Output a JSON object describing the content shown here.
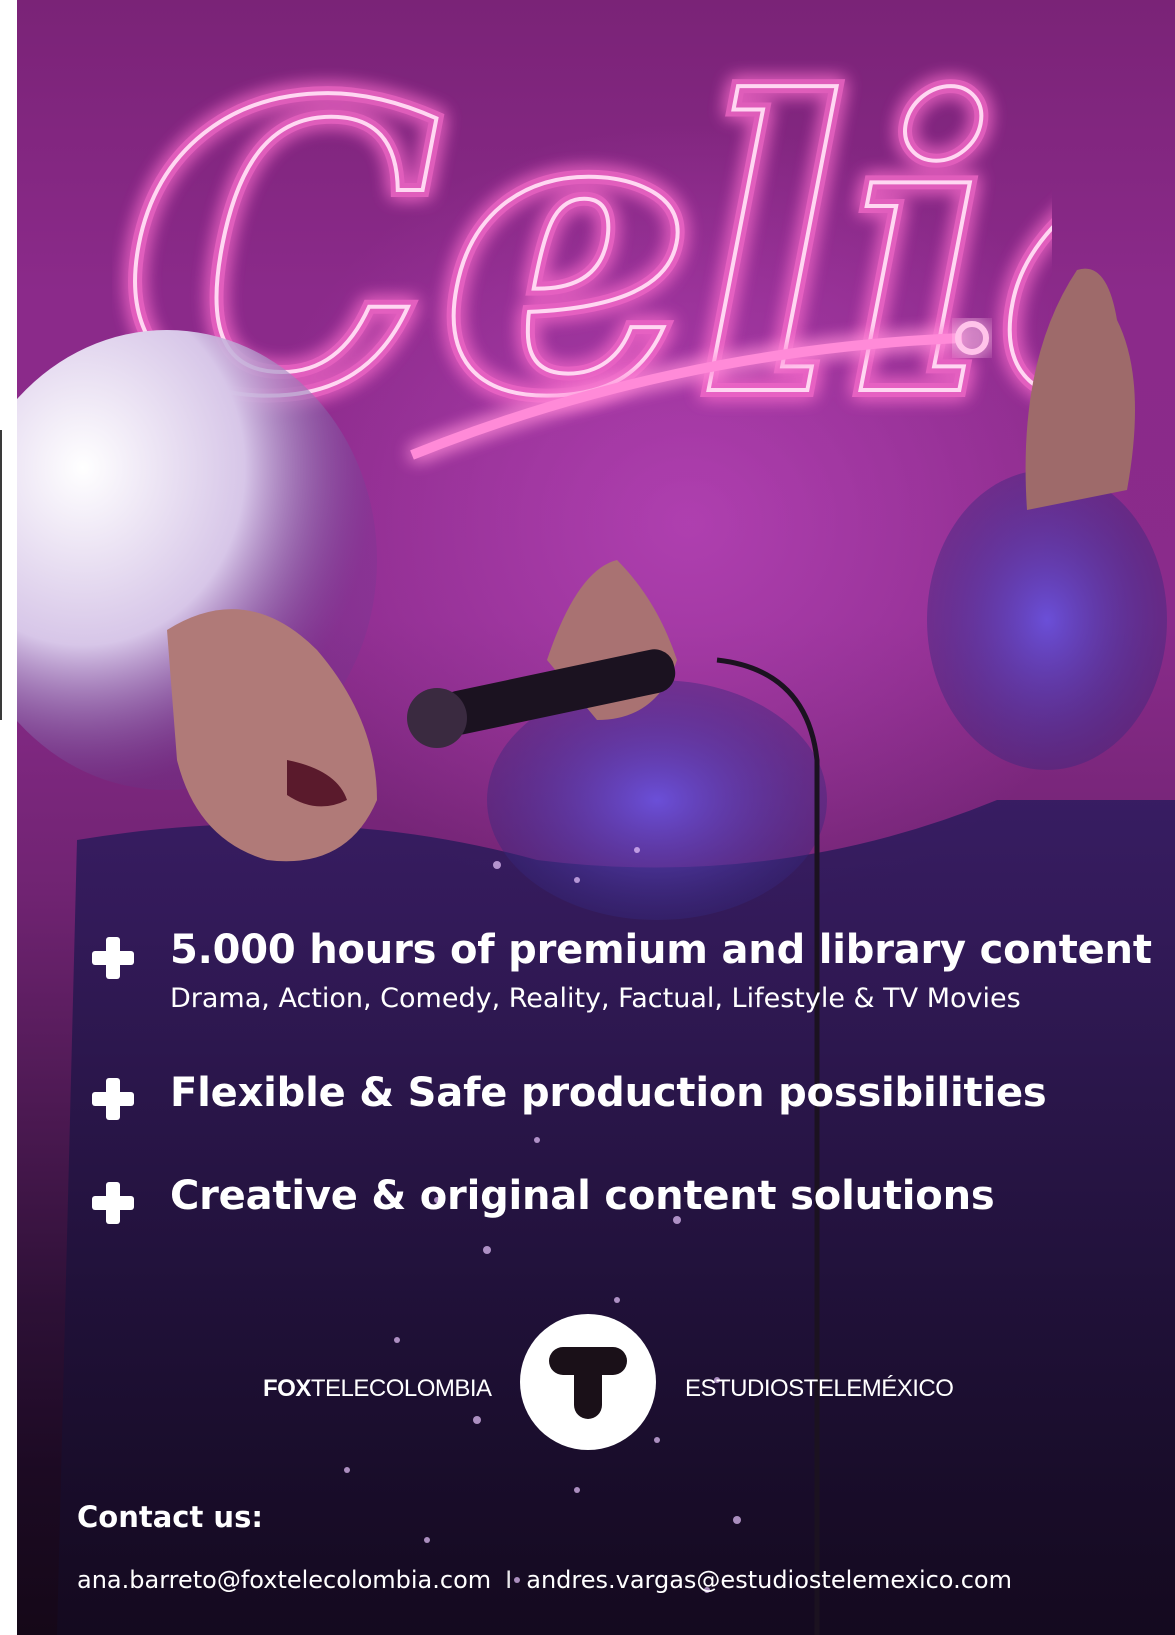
{
  "poster": {
    "title": "Celia",
    "accent_neon": "#ff5fc4",
    "background_color": "#8a2b8b"
  },
  "features": [
    {
      "icon": "plus-icon",
      "title": "5.000 hours of premium and library content",
      "subtitle": "Drama, Action, Comedy, Reality, Factual, Lifestyle & TV Movies"
    },
    {
      "icon": "plus-icon",
      "title": "Flexible & Safe production possibilities"
    },
    {
      "icon": "plus-icon",
      "title": "Creative & original content solutions"
    }
  ],
  "logos": {
    "fox_bold": "FOX",
    "fox_rest": "TELECOLOMBIA",
    "center_letter": "T",
    "right": "ESTUDIOSTELEMÉXICO"
  },
  "contact": {
    "heading": "Contact us:",
    "email_1": "ana.barreto@foxtelecolombia.com",
    "separator": "I",
    "email_2": "andres.vargas@estudiostelemexico.com"
  }
}
